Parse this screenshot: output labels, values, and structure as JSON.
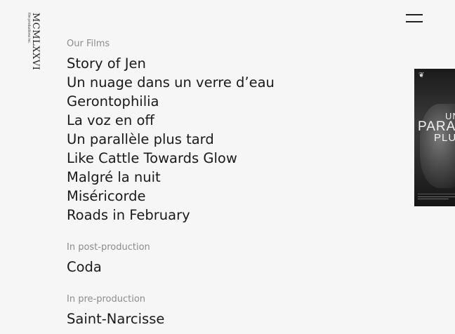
{
  "logo": {
    "main": "MCMLXXVI",
    "sub": "film productions inc."
  },
  "films": {
    "label": "Our Films",
    "items": [
      "Story of Jen",
      "Un nuage dans un verre d’eau",
      "Gerontophilia",
      "La voz en off",
      "Un parallèle plus tard",
      "Like Cattle Towards Glow",
      "Malgré la nuit",
      "Miséricorde",
      "Roads in February"
    ]
  },
  "post_production": {
    "label": "In post-production",
    "items": [
      "Coda"
    ]
  },
  "pre_production": {
    "label": "In pre-production",
    "items": [
      "Saint-Narcisse"
    ]
  },
  "poster": {
    "line1": "UN",
    "line2": "PARA",
    "line3": "PLU"
  },
  "icons": {
    "menu": "hamburger-menu-icon",
    "laurel": "laurel-icon"
  }
}
